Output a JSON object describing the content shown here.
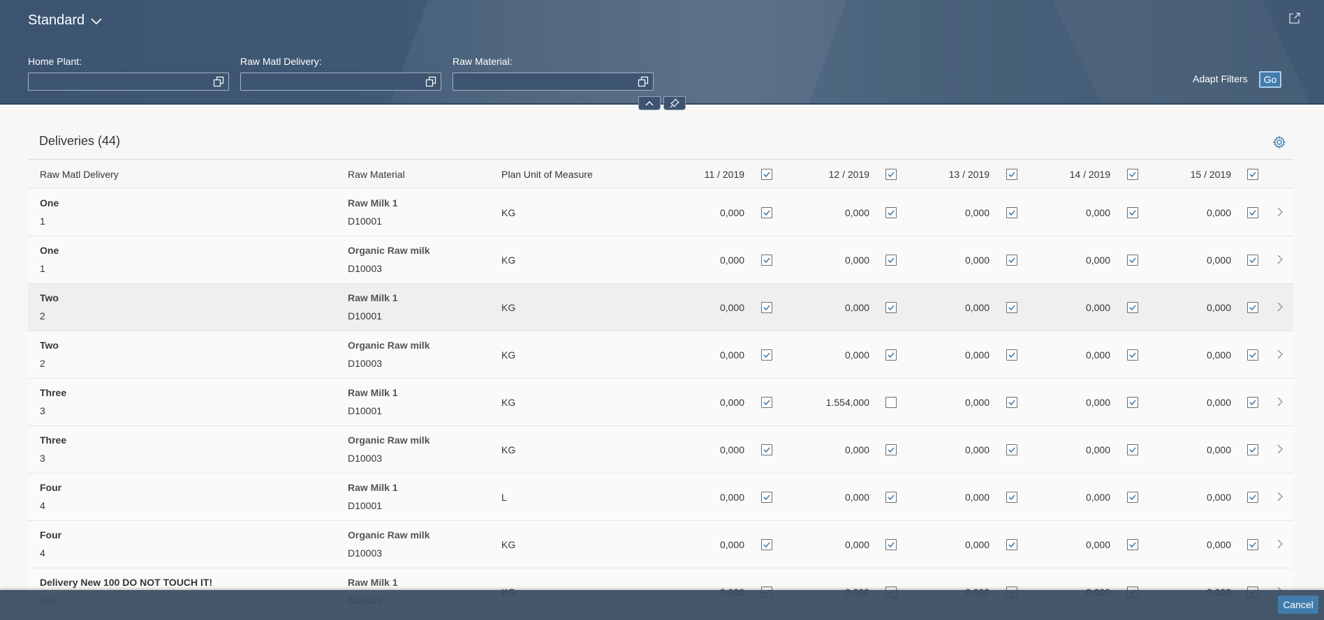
{
  "header": {
    "variant_label": "Standard",
    "adapt_filters_label": "Adapt Filters",
    "go_label": "Go"
  },
  "filters": [
    {
      "label": "Home Plant:",
      "value": ""
    },
    {
      "label": "Raw Matl Delivery:",
      "value": ""
    },
    {
      "label": "Raw Material:",
      "value": ""
    }
  ],
  "table": {
    "title": "Deliveries (44)",
    "columns": {
      "delivery": "Raw Matl Delivery",
      "material": "Raw Material",
      "uom": "Plan Unit of Measure",
      "periods": [
        "11 / 2019",
        "12 / 2019",
        "13 / 2019",
        "14 / 2019",
        "15 / 2019"
      ]
    },
    "header_checks": [
      true,
      true,
      true,
      true,
      true
    ],
    "rows": [
      {
        "delivery_name": "One",
        "delivery_id": "1",
        "material_name": "Raw Milk 1",
        "material_id": "D10001",
        "uom": "KG",
        "values": [
          "0,000",
          "0,000",
          "0,000",
          "0,000",
          "0,000"
        ],
        "checks": [
          true,
          true,
          true,
          true,
          true
        ]
      },
      {
        "delivery_name": "One",
        "delivery_id": "1",
        "material_name": "Organic Raw milk",
        "material_id": "D10003",
        "uom": "KG",
        "values": [
          "0,000",
          "0,000",
          "0,000",
          "0,000",
          "0,000"
        ],
        "checks": [
          true,
          true,
          true,
          true,
          true
        ]
      },
      {
        "delivery_name": "Two",
        "delivery_id": "2",
        "material_name": "Raw Milk 1",
        "material_id": "D10001",
        "uom": "KG",
        "values": [
          "0,000",
          "0,000",
          "0,000",
          "0,000",
          "0,000"
        ],
        "checks": [
          true,
          true,
          true,
          true,
          true
        ]
      },
      {
        "delivery_name": "Two",
        "delivery_id": "2",
        "material_name": "Organic Raw milk",
        "material_id": "D10003",
        "uom": "KG",
        "values": [
          "0,000",
          "0,000",
          "0,000",
          "0,000",
          "0,000"
        ],
        "checks": [
          true,
          true,
          true,
          true,
          true
        ]
      },
      {
        "delivery_name": "Three",
        "delivery_id": "3",
        "material_name": "Raw Milk 1",
        "material_id": "D10001",
        "uom": "KG",
        "values": [
          "0,000",
          "1.554,000",
          "0,000",
          "0,000",
          "0,000"
        ],
        "checks": [
          true,
          false,
          true,
          true,
          true
        ]
      },
      {
        "delivery_name": "Three",
        "delivery_id": "3",
        "material_name": "Organic Raw milk",
        "material_id": "D10003",
        "uom": "KG",
        "values": [
          "0,000",
          "0,000",
          "0,000",
          "0,000",
          "0,000"
        ],
        "checks": [
          true,
          true,
          true,
          true,
          true
        ]
      },
      {
        "delivery_name": "Four",
        "delivery_id": "4",
        "material_name": "Raw Milk 1",
        "material_id": "D10001",
        "uom": "L",
        "values": [
          "0,000",
          "0,000",
          "0,000",
          "0,000",
          "0,000"
        ],
        "checks": [
          true,
          true,
          true,
          true,
          true
        ]
      },
      {
        "delivery_name": "Four",
        "delivery_id": "4",
        "material_name": "Organic Raw milk",
        "material_id": "D10003",
        "uom": "KG",
        "values": [
          "0,000",
          "0,000",
          "0,000",
          "0,000",
          "0,000"
        ],
        "checks": [
          true,
          true,
          true,
          true,
          true
        ]
      },
      {
        "delivery_name": "Delivery New 100 DO NOT TOUCH IT!",
        "delivery_id": "100",
        "material_name": "Raw Milk 1",
        "material_id": "D10001",
        "uom": "KG",
        "values": [
          "0,000",
          "0,000",
          "0,000",
          "0,000",
          "0,000"
        ],
        "checks": [
          true,
          true,
          true,
          true,
          true
        ]
      }
    ]
  },
  "footer": {
    "cancel_label": "Cancel"
  },
  "icons": {
    "variant_dropdown": "chevron-down-icon",
    "share": "share-icon",
    "value_help": "value-help-icon",
    "collapse": "chevron-up-icon",
    "pin": "pin-icon",
    "settings": "gear-icon",
    "navigation": "chevron-right-icon"
  },
  "colors": {
    "header_bg": "#3f5873",
    "accent": "#427cac",
    "footer_bg": "#34495e"
  }
}
